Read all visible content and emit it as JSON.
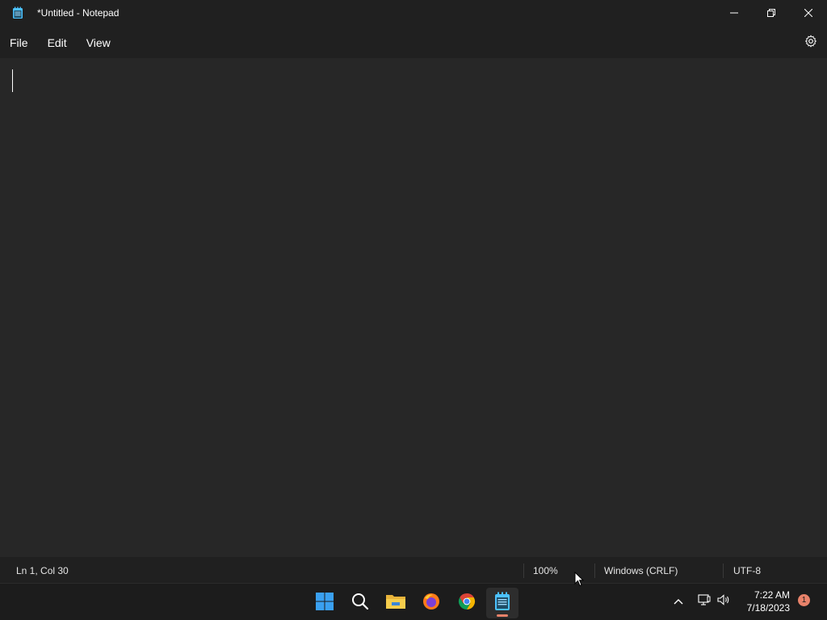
{
  "window": {
    "title": "*Untitled - Notepad",
    "icon": "notepad-icon",
    "controls": [
      "minimize-icon",
      "restore-icon",
      "close-icon"
    ]
  },
  "menu": {
    "items": [
      {
        "label": "File"
      },
      {
        "label": "Edit"
      },
      {
        "label": "View"
      }
    ],
    "settings_icon": "gear-icon"
  },
  "editor": {
    "content": ""
  },
  "status": {
    "position": "Ln 1, Col 30",
    "zoom": "100%",
    "line_ending": "Windows (CRLF)",
    "encoding": "UTF-8"
  },
  "taskbar": {
    "apps": [
      {
        "name": "start-icon"
      },
      {
        "name": "search-icon"
      },
      {
        "name": "file-explorer-icon"
      },
      {
        "name": "firefox-icon"
      },
      {
        "name": "chrome-icon"
      },
      {
        "name": "notepad-icon",
        "active": true
      }
    ],
    "tray": {
      "time": "7:22 AM",
      "date": "7/18/2023",
      "notification_count": "1"
    }
  },
  "colors": {
    "background": "#202020",
    "editor_bg": "#272727",
    "accent": "#e8826a",
    "notepad_blue": "#4cc2ff"
  }
}
